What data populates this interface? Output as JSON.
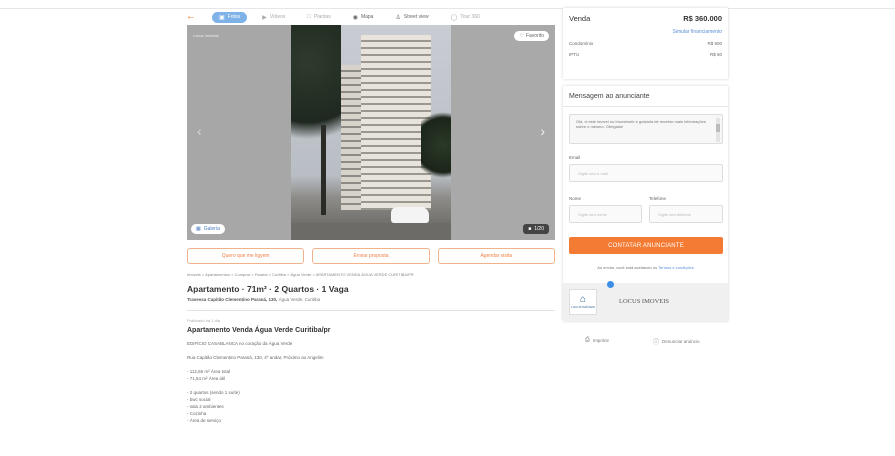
{
  "gallery": {
    "back_icon": "arrow-left-icon",
    "tabs": [
      {
        "label": "Fotos",
        "icon": "camera-icon",
        "active": true
      },
      {
        "label": "Vídeos",
        "icon": "video-icon",
        "active": false
      },
      {
        "label": "Plantas",
        "icon": "floorplan-icon",
        "active": false
      },
      {
        "label": "Mapa",
        "icon": "map-pin-icon",
        "active": false
      },
      {
        "label": "Street view",
        "icon": "person-icon",
        "active": false
      },
      {
        "label": "Tour 360",
        "icon": "tour-icon",
        "active": false
      }
    ],
    "agency_watermark": "Locus Imóveis",
    "favorite_label": "Favorito",
    "galeria_label": "Galeria",
    "photo_count": "1/20"
  },
  "actions": {
    "visit": "Quero que me ligyem",
    "send_proposal": "Enviar proposta",
    "schedule": "Agendar visita"
  },
  "breadcrumb": "Imóveis > Apartamentos > Comprar > Paraná > Curitiba > Água Verde > APARTAMENTO VENDA ÁGUA VERDE CURITIBA/PR",
  "listing": {
    "title": "Apartamento · 71m² · 2 Quartos · 1 Vaga",
    "address_street": "Travessa Capitão Clementino Paraná, 130,",
    "address_area": "Água Verde, Curitiba",
    "reference": "Publicado há 1 dia",
    "desc_title": "Apartamento Venda Água Verde Curitiba/pr",
    "desc_lines": [
      "EDIFÍCIO CASABLANCA no coração da Água Verde",
      "",
      "Rua Capitão Clementino Paraná, 130, 4º andar, Próximo ao Angelim",
      "",
      "- 112,65 m² Área total",
      "- 71,54 m² Área útil",
      "",
      "- 2 quartos (sendo 1 suíte)",
      "- bwc social",
      "- sala 2 ambientes",
      "- Cozinha",
      "- Área de serviço"
    ]
  },
  "price": {
    "label": "Venda",
    "value": "R$ 360.000",
    "simulate": "Simular financiamento",
    "condo_label": "Condomínio",
    "condo_value": "R$ 500",
    "iptu_label": "IPTU",
    "iptu_value": "R$ 60"
  },
  "contact": {
    "title": "Mensagem ao anunciante",
    "message": "Olá, vi este imóvel no Imovelweb e gostaria de receber mais informações sobre o mesmo. Obrigado!",
    "email_label": "Email",
    "email_placeholder": "Digite seu e-mail",
    "name_label": "Nome",
    "name_placeholder": "Digite seu nome",
    "phone_label": "Telefone",
    "phone_placeholder": "Digite seu telefone",
    "cta": "CONTATAR ANUNCIANTE",
    "terms_prefix": "Ao enviar, você está aceitando os",
    "terms_link": "Termos e condições",
    "agency_logo_text": "LOCUS IMÓVEIS",
    "agency_name": "LOCUS IMOVEIS"
  },
  "footer_links": {
    "print": "Imprimir",
    "report": "Denunciar anúncio"
  },
  "colors": {
    "accent": "#f47b34",
    "link": "#5a8fd6",
    "active_tab": "#7fb3e8"
  }
}
